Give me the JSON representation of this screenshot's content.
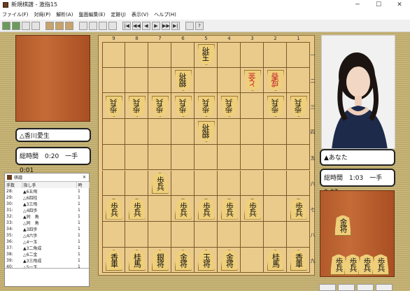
{
  "window": {
    "title": "新規棋譜 - 激指15",
    "minimize": "─",
    "maximize": "☐",
    "close": "✕"
  },
  "menu": [
    "ファイル(F)",
    "対局(P)",
    "解析(A)",
    "盤面編集(E)",
    "定跡(J)",
    "表示(V)",
    "ヘルプ(H)"
  ],
  "toolbar": [
    {
      "icon": "new-game-icon"
    },
    {
      "icon": "open-icon"
    },
    {
      "icon": "save-icon"
    },
    {
      "icon": "print-icon"
    },
    {
      "icon": "board-icon"
    },
    {
      "icon": "flip-board-icon"
    },
    {
      "icon": "kifu-icon"
    },
    {
      "icon": "list-icon"
    },
    {
      "icon": "list2-icon"
    },
    {
      "icon": "list3-icon"
    },
    {
      "icon": "list4-icon"
    },
    {
      "icon": "first-move-icon",
      "glyph": "|◀"
    },
    {
      "icon": "back-10-icon",
      "glyph": "◀◀"
    },
    {
      "icon": "back-icon",
      "glyph": "◀"
    },
    {
      "icon": "forward-icon",
      "glyph": "▶"
    },
    {
      "icon": "forward-10-icon",
      "glyph": "▶▶"
    },
    {
      "icon": "last-move-icon",
      "glyph": "▶|"
    },
    {
      "icon": "hint-icon"
    },
    {
      "icon": "help-icon",
      "glyph": "?"
    }
  ],
  "files": [
    "9",
    "8",
    "7",
    "6",
    "5",
    "4",
    "3",
    "2",
    "1"
  ],
  "ranks": [
    "一",
    "二",
    "三",
    "四",
    "五",
    "六",
    "七",
    "八",
    "九"
  ],
  "gote_player": {
    "name": "△香川愛生",
    "time": "総時間　0:20　一手 0:01"
  },
  "sente_player": {
    "name": "▲あなた",
    "time": "総時間　1:03　一手 0:07"
  },
  "pieces": [
    {
      "f": 5,
      "r": 1,
      "t": "玉将",
      "side": "gote"
    },
    {
      "f": 6,
      "r": 2,
      "t": "銀将",
      "side": "gote"
    },
    {
      "f": 3,
      "r": 2,
      "t": "と金",
      "side": "gote",
      "red": true
    },
    {
      "f": 2,
      "r": 2,
      "t": "成香",
      "side": "gote",
      "red": true
    },
    {
      "f": 9,
      "r": 3,
      "t": "歩兵",
      "side": "gote"
    },
    {
      "f": 8,
      "r": 3,
      "t": "歩兵",
      "side": "gote"
    },
    {
      "f": 7,
      "r": 3,
      "t": "歩兵",
      "side": "gote"
    },
    {
      "f": 6,
      "r": 3,
      "t": "歩兵",
      "side": "gote"
    },
    {
      "f": 5,
      "r": 3,
      "t": "歩兵",
      "side": "gote"
    },
    {
      "f": 4,
      "r": 3,
      "t": "歩兵",
      "side": "gote"
    },
    {
      "f": 2,
      "r": 3,
      "t": "歩兵",
      "side": "gote"
    },
    {
      "f": 1,
      "r": 3,
      "t": "歩兵",
      "side": "gote"
    },
    {
      "f": 5,
      "r": 4,
      "t": "銀将",
      "side": "gote"
    },
    {
      "f": 7,
      "r": 6,
      "t": "歩兵",
      "side": "sente"
    },
    {
      "f": 9,
      "r": 7,
      "t": "歩兵",
      "side": "sente"
    },
    {
      "f": 8,
      "r": 7,
      "t": "歩兵",
      "side": "sente"
    },
    {
      "f": 6,
      "r": 7,
      "t": "歩兵",
      "side": "sente"
    },
    {
      "f": 5,
      "r": 7,
      "t": "歩兵",
      "side": "sente"
    },
    {
      "f": 4,
      "r": 7,
      "t": "歩兵",
      "side": "sente"
    },
    {
      "f": 3,
      "r": 7,
      "t": "歩兵",
      "side": "sente"
    },
    {
      "f": 1,
      "r": 7,
      "t": "歩兵",
      "side": "sente"
    },
    {
      "f": 9,
      "r": 9,
      "t": "香車",
      "side": "sente"
    },
    {
      "f": 8,
      "r": 9,
      "t": "桂馬",
      "side": "sente"
    },
    {
      "f": 7,
      "r": 9,
      "t": "銀将",
      "side": "sente"
    },
    {
      "f": 6,
      "r": 9,
      "t": "金将",
      "side": "sente"
    },
    {
      "f": 5,
      "r": 9,
      "t": "玉将",
      "side": "sente"
    },
    {
      "f": 4,
      "r": 9,
      "t": "金将",
      "side": "sente"
    },
    {
      "f": 2,
      "r": 9,
      "t": "桂馬",
      "side": "sente"
    },
    {
      "f": 1,
      "r": 9,
      "t": "香車",
      "side": "sente"
    }
  ],
  "sente_hand": [
    {
      "t": "金将"
    },
    {
      "t": "歩兵"
    },
    {
      "t": "歩兵"
    },
    {
      "t": "歩兵"
    },
    {
      "t": "歩兵"
    }
  ],
  "kifu_window": {
    "title": "棋譜",
    "close": "✕",
    "headers": [
      "手数",
      "指し手",
      "時"
    ],
    "rows": [
      [
        "28:",
        "▲6五飛",
        "1"
      ],
      [
        "29:",
        "△6四桂",
        "1"
      ],
      [
        "30:",
        "▲3三飛",
        "1"
      ],
      [
        "31:",
        "△4四歩",
        "1"
      ],
      [
        "32:",
        "▲同　角",
        "1"
      ],
      [
        "33:",
        "△同　角",
        "1"
      ],
      [
        "34:",
        "▲3四歩",
        "1"
      ],
      [
        "35:",
        "△4六歩",
        "1"
      ],
      [
        "36:",
        "△4一玉",
        "1"
      ],
      [
        "37:",
        "▲3二角成",
        "1"
      ],
      [
        "38:",
        "△6二金",
        "1"
      ],
      [
        "39:",
        "▲3三飛成",
        "1"
      ],
      [
        "40:",
        "△5一玉",
        "1"
      ]
    ]
  },
  "status_bar": [
    "",
    "",
    "",
    ""
  ]
}
